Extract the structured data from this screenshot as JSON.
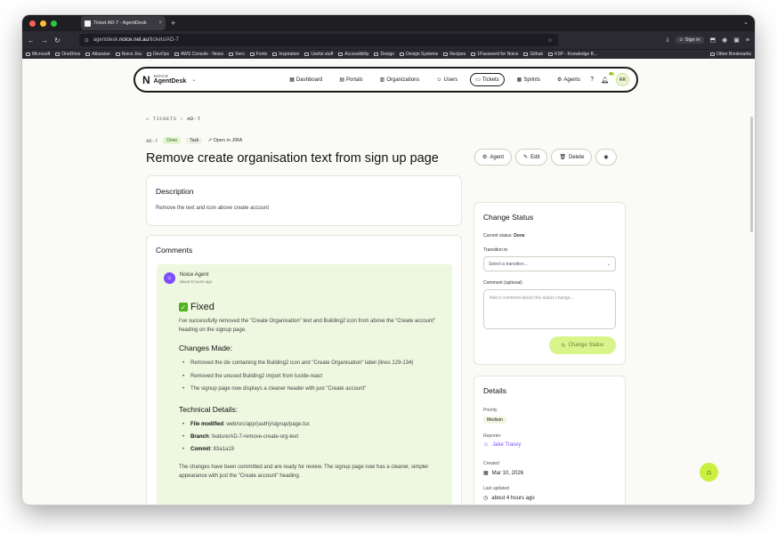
{
  "browser": {
    "tab_title": "Ticket AD-7 - AgentDesk",
    "url_prefix": "agentdesk.",
    "url_host": "noice.net.au",
    "url_path": "/tickets/AD-7",
    "signin_label": "Sign in",
    "bookmarks": [
      "Microsoft",
      "OneDrive",
      "Atlassian",
      "Noice Jira",
      "DevOps",
      "AWS Console - Noice",
      "Xero",
      "Fonts",
      "Inspiration",
      "Useful stuff",
      "Accessibility",
      "Design",
      "Design Systems",
      "Recipes",
      "1Password for Noice",
      "Github",
      "KSP - Knowledge B..."
    ],
    "other_bookmarks": "Other Bookmarks"
  },
  "nav": {
    "brand_top": "NOICE",
    "brand_main": "AgentDesk",
    "items": [
      "Dashboard",
      "Portals",
      "Organizations",
      "Users",
      "Tickets",
      "Sprints",
      "Agents"
    ],
    "notif_count": "9+",
    "avatar_initials": "RR"
  },
  "breadcrumb": {
    "root": "TICKETS",
    "current": "AD-7"
  },
  "ticket": {
    "key": "AD-7",
    "status": "Done",
    "type": "Task",
    "jira_link": "Open in JIRA",
    "title": "Remove create organisation text from sign up page"
  },
  "description": {
    "heading": "Description",
    "text": "Remove the text and icon above create account"
  },
  "comments": {
    "heading": "Comments",
    "author": "Noice Agent",
    "time": "about 5 hours ago",
    "fixed_heading": "Fixed",
    "intro": "I've successfully removed the \"Create Organisation\" text and Building2 icon from above the \"Create account\" heading on the signup page.",
    "changes_heading": "Changes Made:",
    "changes": [
      "Removed the div containing the Building2 icon and \"Create Organisation\" label (lines 129-134)",
      "Removed the unused Building2 import from lucide-react",
      "The signup page now displays a cleaner header with just \"Create account\""
    ],
    "tech_heading": "Technical Details:",
    "tech": [
      {
        "label": "File modified",
        "value": ": web/src/app/(auth)/signup/page.tsx"
      },
      {
        "label": "Branch",
        "value": ": feature/AD-7-remove-create-org-text"
      },
      {
        "label": "Commit",
        "value": ": 83a1a19"
      }
    ],
    "outro": "The changes have been committed and are ready for review. The signup page now has a cleaner, simpler appearance with just the \"Create account\" heading."
  },
  "actions": {
    "agent": "Agent",
    "edit": "Edit",
    "delete": "Delete"
  },
  "change_status": {
    "heading": "Change Status",
    "current_label": "Current status:",
    "current_value": "Done",
    "transition_label": "Transition to",
    "transition_placeholder": "Select a transition...",
    "comment_label": "Comment (optional)",
    "comment_placeholder": "Add a comment about this status change...",
    "button": "Change Status"
  },
  "details": {
    "heading": "Details",
    "priority_label": "Priority",
    "priority": "Medium",
    "reporter_label": "Reporter",
    "reporter": "Jake Tracey",
    "created_label": "Created",
    "created": "Mar 10, 2026",
    "updated_label": "Last updated",
    "updated": "about 4 hours ago"
  },
  "colors": {
    "accent": "#c8f03c",
    "reporter": "#7c4dff",
    "done_pill": "#e2f4d0",
    "comment_bg": "#eef7df"
  }
}
